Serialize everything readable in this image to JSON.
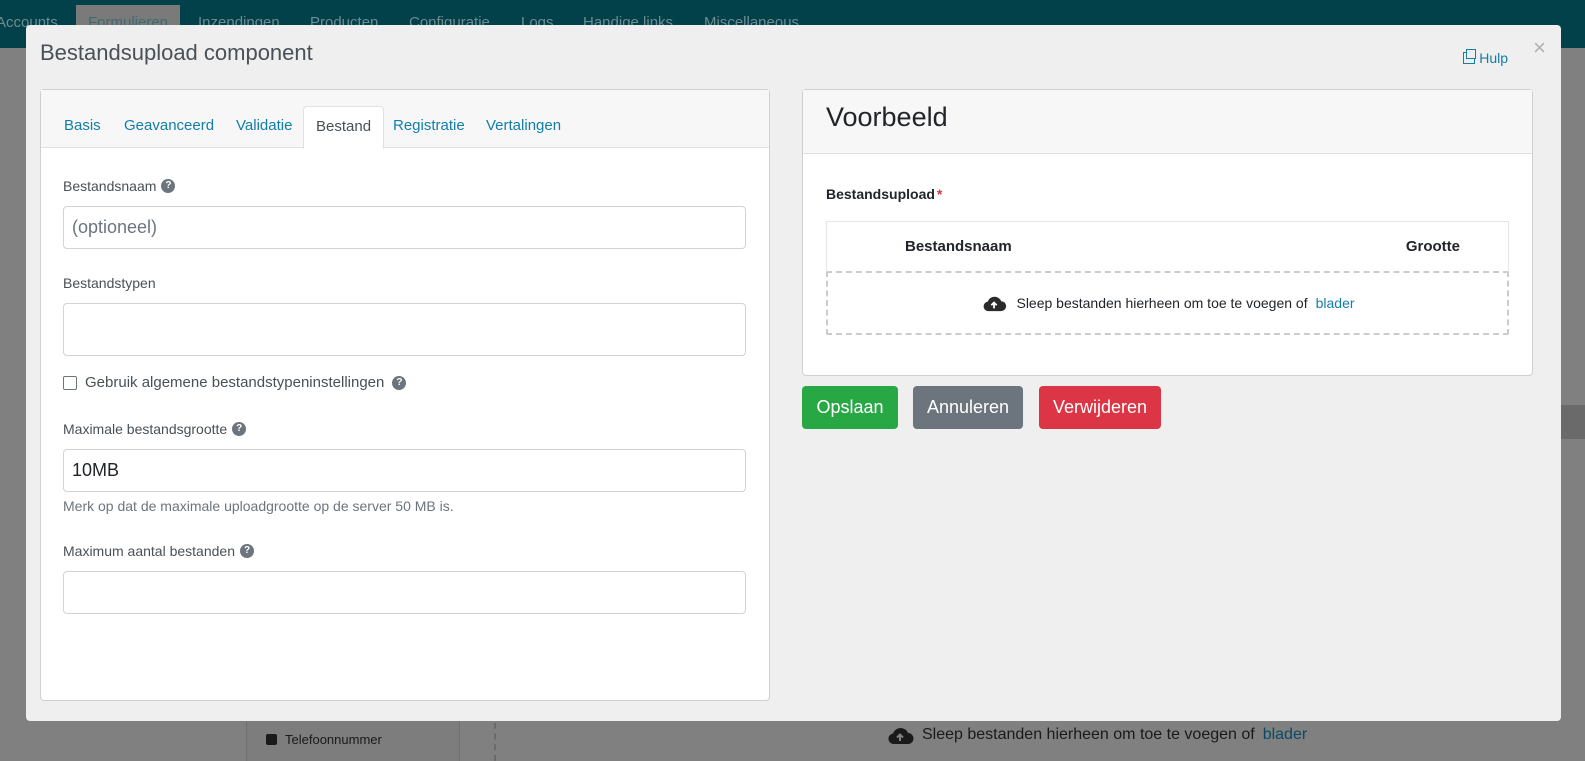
{
  "background": {
    "nav_items": [
      {
        "label": "Accounts",
        "active": false
      },
      {
        "label": "Formulieren",
        "active": true
      },
      {
        "label": "Inzendingen",
        "active": false
      },
      {
        "label": "Producten",
        "active": false
      },
      {
        "label": "Configuratie",
        "active": false
      },
      {
        "label": "Logs",
        "active": false
      },
      {
        "label": "Handige links",
        "active": false
      },
      {
        "label": "Miscellaneous",
        "active": false
      }
    ],
    "phone_item": "Telefoonnummer",
    "drop_text": "Sleep bestanden hierheen om toe te voegen of",
    "drop_link": "blader"
  },
  "modal": {
    "title": "Bestandsupload component",
    "help_label": "Hulp",
    "close_label": "×"
  },
  "tabs": [
    {
      "label": "Basis",
      "active": false
    },
    {
      "label": "Geavanceerd",
      "active": false
    },
    {
      "label": "Validatie",
      "active": false
    },
    {
      "label": "Bestand",
      "active": true
    },
    {
      "label": "Registratie",
      "active": false
    },
    {
      "label": "Vertalingen",
      "active": false
    }
  ],
  "form": {
    "filename_label": "Bestandsnaam",
    "filename_placeholder": "(optioneel)",
    "filename_value": "",
    "filetypes_label": "Bestandstypen",
    "global_settings_label": "Gebruik algemene bestandstypeninstellingen",
    "global_settings_checked": false,
    "maxsize_label": "Maximale bestandsgrootte",
    "maxsize_value": "10MB",
    "maxsize_hint": "Merk op dat de maximale uploadgrootte op de server 50 MB is.",
    "maxfiles_label": "Maximum aantal bestanden",
    "maxfiles_value": "",
    "help_glyph": "?"
  },
  "preview": {
    "heading": "Voorbeeld",
    "upload_label": "Bestandsupload",
    "required_marker": "*",
    "col_name": "Bestandsnaam",
    "col_size": "Grootte",
    "drop_text": "Sleep bestanden hierheen om toe te voegen of",
    "drop_link": "blader"
  },
  "buttons": {
    "save": "Opslaan",
    "cancel": "Annuleren",
    "delete": "Verwijderen"
  },
  "colors": {
    "accent": "#137ea8",
    "save": "#28a745",
    "cancel": "#6c757d",
    "delete": "#dc3545",
    "required": "#dc3545"
  }
}
